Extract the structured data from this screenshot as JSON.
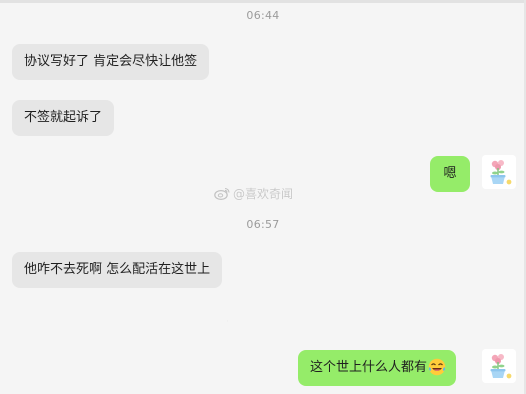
{
  "chat": {
    "timestamp_1": "06:44",
    "timestamp_2": "06:57",
    "messages": [
      {
        "side": "left",
        "text": "协议写好了 肯定会尽快让他签"
      },
      {
        "side": "left",
        "text": "不签就起诉了"
      },
      {
        "side": "right",
        "text": "嗯"
      },
      {
        "side": "left",
        "text": "他咋不去死啊 怎么配活在这世上"
      },
      {
        "side": "right",
        "text": "这个世上什么人都有",
        "emoji": "laughing-crying-face-icon"
      }
    ]
  },
  "watermark": {
    "text": "@喜欢奇闻",
    "icon": "weibo-icon"
  },
  "colors": {
    "background": "#f5f5f5",
    "incoming_bubble": "#e6e6e6",
    "outgoing_bubble": "#95ec69",
    "timestamp": "#9b9b9b"
  }
}
